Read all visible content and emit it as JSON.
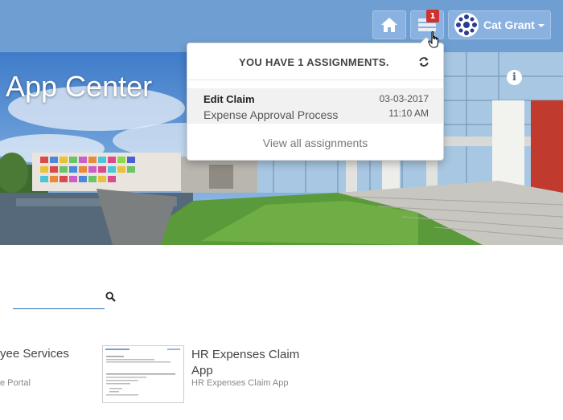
{
  "header": {
    "home_icon": "home-icon",
    "tasks_icon": "tasks-icon",
    "tasks_badge": "1",
    "user_name": "Cat Grant"
  },
  "hero": {
    "title": "App Center"
  },
  "assignments": {
    "heading": "YOU HAVE 1 ASSIGNMENTS.",
    "items": [
      {
        "title": "Edit Claim",
        "process": "Expense Approval Process",
        "date": "03-03-2017",
        "time": "11:10 AM"
      }
    ],
    "view_all": "View all assignments"
  },
  "search": {
    "placeholder": "",
    "icon": "search-icon"
  },
  "apps": [
    {
      "title": "yee Services",
      "subtitle": "e Portal"
    },
    {
      "title": "HR Expenses Claim App",
      "subtitle": "HR Expenses Claim App"
    }
  ],
  "colors": {
    "topbar": "#6f9fd2",
    "badge": "#d2322d",
    "search_underline": "#2a6fb5"
  }
}
